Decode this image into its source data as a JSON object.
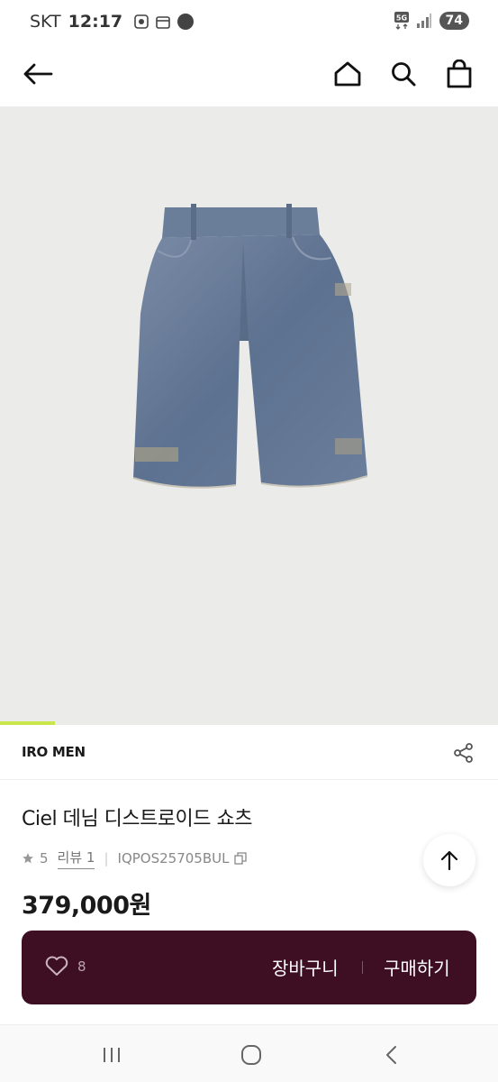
{
  "status_bar": {
    "carrier": "SKT",
    "time": "12:17",
    "network": "5G",
    "battery": "74"
  },
  "header": {
    "back_icon": "arrow-left-icon",
    "home_icon": "home-icon",
    "search_icon": "search-icon",
    "bag_icon": "shopping-bag-icon"
  },
  "product": {
    "image_progress": 0.11,
    "brand": "IRO MEN",
    "title": "Ciel 데님 디스트로이드 쇼츠",
    "rating": "5",
    "review_label": "리뷰 1",
    "product_code": "IQPOS25705BUL",
    "price": "379,000원"
  },
  "purchase_bar": {
    "wish_count": "8",
    "cart_label": "장바구니",
    "buy_label": "구매하기",
    "background_color": "#3e0f22"
  },
  "colors": {
    "accent_progress": "#c9e54a",
    "image_background": "#ebebea"
  }
}
